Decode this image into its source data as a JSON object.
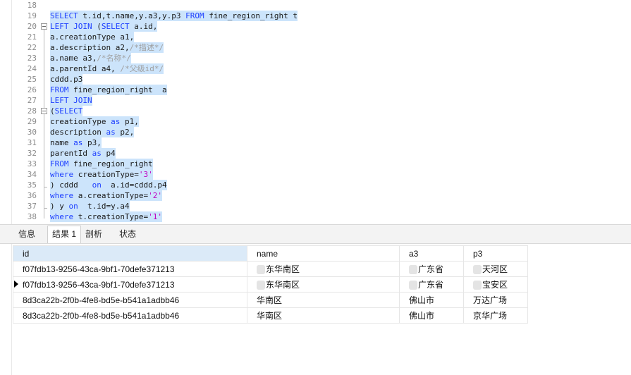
{
  "editor": {
    "lines": [
      {
        "num": "18",
        "code": ""
      },
      {
        "num": "19",
        "code": "SELECT t.id,t.name,y.a3,y.p3 FROM fine_region_right t"
      },
      {
        "num": "20",
        "code": "LEFT JOIN (SELECT a.id,"
      },
      {
        "num": "21",
        "code": "a.creationType a1,"
      },
      {
        "num": "22",
        "code": "a.description a2,/*描述*/"
      },
      {
        "num": "23",
        "code": "a.name a3,/*名称*/"
      },
      {
        "num": "24",
        "code": "a.parentId a4, /*父级id*/"
      },
      {
        "num": "25",
        "code": "cddd.p3"
      },
      {
        "num": "26",
        "code": "FROM fine_region_right  a"
      },
      {
        "num": "27",
        "code": "LEFT JOIN"
      },
      {
        "num": "28",
        "code": "(SELECT"
      },
      {
        "num": "29",
        "code": "creationType as p1,"
      },
      {
        "num": "30",
        "code": "description as p2,"
      },
      {
        "num": "31",
        "code": "name as p3,"
      },
      {
        "num": "32",
        "code": "parentId as p4"
      },
      {
        "num": "33",
        "code": "FROM fine_region_right"
      },
      {
        "num": "34",
        "code": "where creationType='3'"
      },
      {
        "num": "35",
        "code": ") cddd   on  a.id=cddd.p4"
      },
      {
        "num": "36",
        "code": "where a.creationType='2'"
      },
      {
        "num": "37",
        "code": ") y on  t.id=y.a4"
      },
      {
        "num": "38",
        "code": "where t.creationType='1'"
      }
    ]
  },
  "tabs": [
    "信息",
    "结果 1",
    "剖析",
    "状态"
  ],
  "results": {
    "columns": [
      "id",
      "name",
      "a3",
      "p3"
    ],
    "rows": [
      [
        "f07fdb13-9256-43ca-9bf1-70defe371213",
        "东华南区",
        "广东省",
        "天河区"
      ],
      [
        "f07fdb13-9256-43ca-9bf1-70defe371213",
        "东华南区",
        "广东省",
        "宝安区"
      ],
      [
        "8d3ca22b-2f0b-4fe8-bd5e-b541a1adbb46",
        "华南区",
        "佛山市",
        "万达广场"
      ],
      [
        "8d3ca22b-2f0b-4fe8-bd5e-b541a1adbb46",
        "华南区",
        "佛山市",
        "京华广场"
      ]
    ]
  }
}
